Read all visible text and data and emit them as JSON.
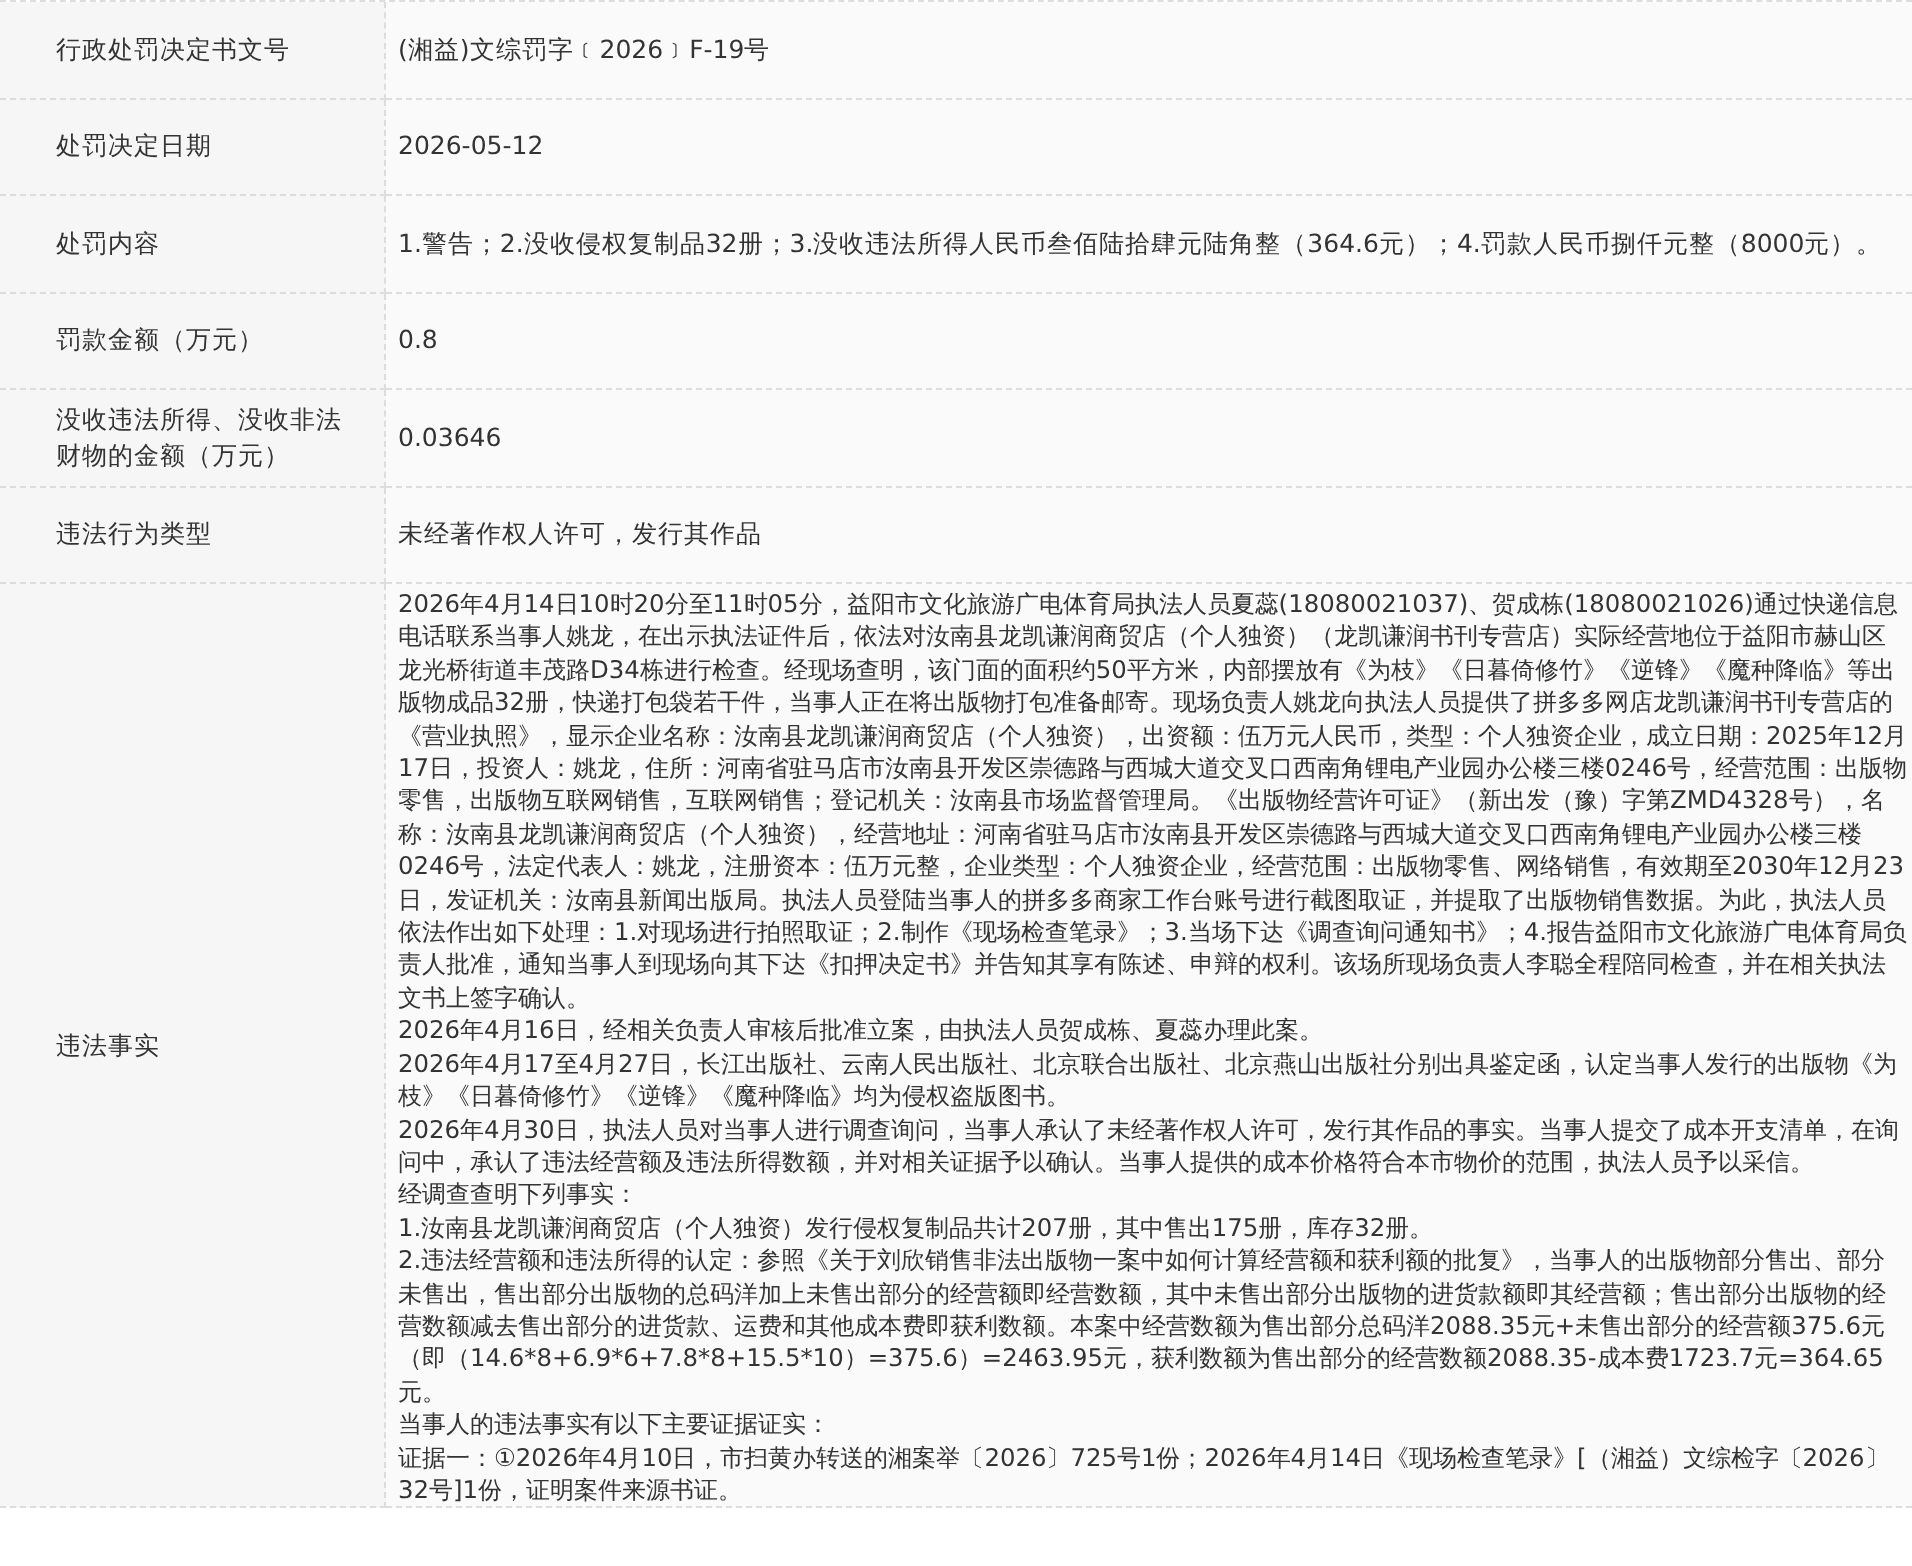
{
  "rows": [
    {
      "label": "行政处罚决定书文号",
      "value": "(湘益)文综罚字﹝2026﹞F-19号"
    },
    {
      "label": "处罚决定日期",
      "value": "2026-05-12"
    },
    {
      "label": "处罚内容",
      "value": "1.警告；2.没收侵权复制品32册；3.没收违法所得人民币叁佰陆拾肆元陆角整（364.6元）；4.罚款人民币捌仟元整（8000元）。"
    },
    {
      "label": "罚款金额（万元）",
      "value": "0.8"
    },
    {
      "label": "没收违法所得、没收非法财物的金额（万元）",
      "value": "0.03646"
    },
    {
      "label": "违法行为类型",
      "value": "未经著作权人许可，发行其作品"
    },
    {
      "label": "违法事实",
      "paragraphs": [
        "2026年4月14日10时20分至11时05分，益阳市文化旅游广电体育局执法人员夏蕊(18080021037)、贺成栋(18080021026)通过快递信息电话联系当事人姚龙，在出示执法证件后，依法对汝南县龙凯谦润商贸店（个人独资）（龙凯谦润书刊专营店）实际经营地位于益阳市赫山区龙光桥街道丰茂路D34栋进行检查。经现场查明，该门面的面积约50平方米，内部摆放有《为枝》《日暮倚修竹》《逆锋》《魔种降临》等出版物成品32册，快递打包袋若干件，当事人正在将出版物打包准备邮寄。现场负责人姚龙向执法人员提供了拼多多网店龙凯谦润书刊专营店的《营业执照》，显示企业名称：汝南县龙凯谦润商贸店（个人独资），出资额：伍万元人民币，类型：个人独资企业，成立日期：2025年12月17日，投资人：姚龙，住所：河南省驻马店市汝南县开发区崇德路与西城大道交叉口西南角锂电产业园办公楼三楼0246号，经营范围：出版物零售，出版物互联网销售，互联网销售；登记机关：汝南县市场监督管理局。《出版物经营许可证》（新出发（豫）字第ZMD4328号），名称：汝南县龙凯谦润商贸店（个人独资），经营地址：河南省驻马店市汝南县开发区崇德路与西城大道交叉口西南角锂电产业园办公楼三楼0246号，法定代表人：姚龙，注册资本：伍万元整，企业类型：个人独资企业，经营范围：出版物零售、网络销售，有效期至2030年12月23日，发证机关：汝南县新闻出版局。执法人员登陆当事人的拼多多商家工作台账号进行截图取证，并提取了出版物销售数据。为此，执法人员依法作出如下处理：1.对现场进行拍照取证；2.制作《现场检查笔录》；3.当场下达《调查询问通知书》；4.报告益阳市文化旅游广电体育局负责人批准，通知当事人到现场向其下达《扣押决定书》并告知其享有陈述、申辩的权利。该场所现场负责人李聪全程陪同检查，并在相关执法文书上签字确认。",
        "2026年4月16日，经相关负责人审核后批准立案，由执法人员贺成栋、夏蕊办理此案。",
        "2026年4月17至4月27日，长江出版社、云南人民出版社、北京联合出版社、北京燕山出版社分别出具鉴定函，认定当事人发行的出版物《为枝》《日暮倚修竹》《逆锋》《魔种降临》均为侵权盗版图书。",
        "2026年4月30日，执法人员对当事人进行调查询问，当事人承认了未经著作权人许可，发行其作品的事实。当事人提交了成本开支清单，在询问中，承认了违法经营额及违法所得数额，并对相关证据予以确认。当事人提供的成本价格符合本市物价的范围，执法人员予以采信。",
        "经调查查明下列事实：",
        "1.汝南县龙凯谦润商贸店（个人独资）发行侵权复制品共计207册，其中售出175册，库存32册。",
        "2.违法经营额和违法所得的认定：参照《关于刘欣销售非法出版物一案中如何计算经营额和获利额的批复》，当事人的出版物部分售出、部分未售出，售出部分出版物的总码洋加上未售出部分的经营额即经营数额，其中未售出部分出版物的进货款额即其经营额；售出部分出版物的经营数额减去售出部分的进货款、运费和其他成本费即获利数额。本案中经营数额为售出部分总码洋2088.35元+未售出部分的经营额375.6元（即（14.6*8+6.9*6+7.8*8+15.5*10）=375.6）=2463.95元，获利数额为售出部分的经营数额2088.35-成本费1723.7元=364.65元。",
        "当事人的违法事实有以下主要证据证实：",
        "证据一：①2026年4月10日，市扫黄办转送的湘案举〔2026〕725号1份；2026年4月14日《现场检查笔录》[（湘益）文综检字〔2026〕32号]1份，证明案件来源书证。"
      ]
    }
  ]
}
